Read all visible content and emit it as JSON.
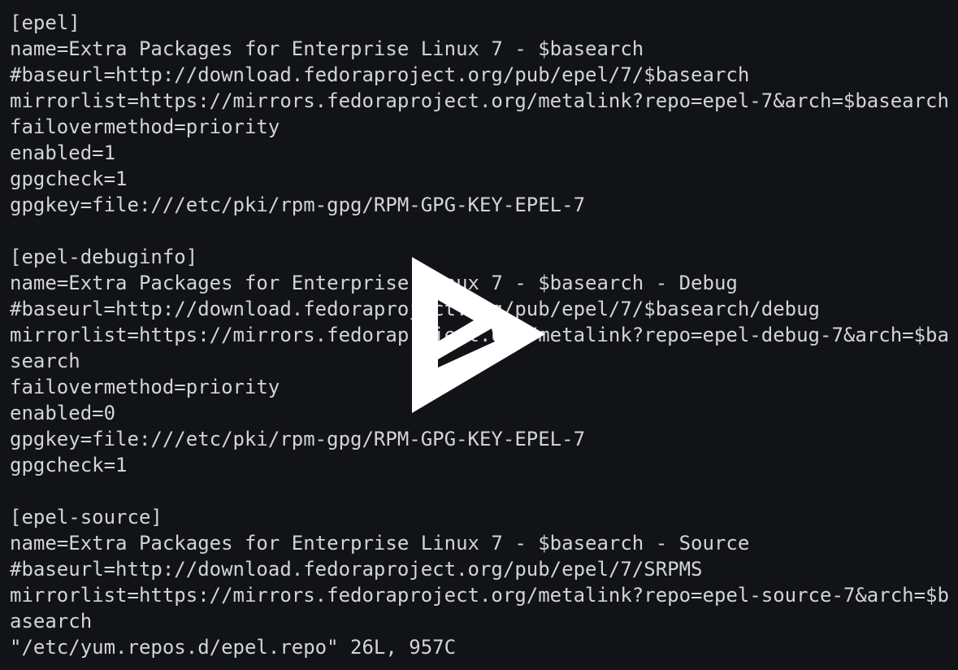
{
  "terminal": {
    "lines": [
      "[epel]",
      "name=Extra Packages for Enterprise Linux 7 - $basearch",
      "#baseurl=http://download.fedoraproject.org/pub/epel/7/$basearch",
      "mirrorlist=https://mirrors.fedoraproject.org/metalink?repo=epel-7&arch=$basearch",
      "failovermethod=priority",
      "enabled=1",
      "gpgcheck=1",
      "gpgkey=file:///etc/pki/rpm-gpg/RPM-GPG-KEY-EPEL-7",
      "",
      "[epel-debuginfo]",
      "name=Extra Packages for Enterprise Linux 7 - $basearch - Debug",
      "#baseurl=http://download.fedoraproject.org/pub/epel/7/$basearch/debug",
      "mirrorlist=https://mirrors.fedoraproject.org/metalink?repo=epel-debug-7&arch=$ba",
      "search",
      "failovermethod=priority",
      "enabled=0",
      "gpgkey=file:///etc/pki/rpm-gpg/RPM-GPG-KEY-EPEL-7",
      "gpgcheck=1",
      "",
      "[epel-source]",
      "name=Extra Packages for Enterprise Linux 7 - $basearch - Source",
      "#baseurl=http://download.fedoraproject.org/pub/epel/7/SRPMS",
      "mirrorlist=https://mirrors.fedoraproject.org/metalink?repo=epel-source-7&arch=$b",
      "asearch"
    ],
    "status_line": "\"/etc/yum.repos.d/epel.repo\" 26L, 957C"
  },
  "overlay": {
    "icon": "asciinema-play-icon",
    "color": "#ffffff"
  },
  "colors": {
    "background": "#121316",
    "text": "#d2d4d6"
  }
}
